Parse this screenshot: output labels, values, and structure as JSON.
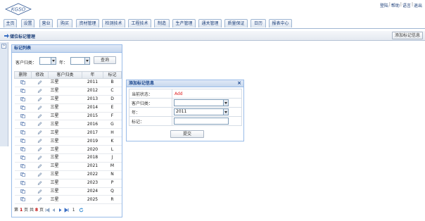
{
  "header": {
    "logo_text": "KGSO",
    "links": [
      "登陆",
      "帮助",
      "语言",
      "退出"
    ]
  },
  "menu": {
    "tabs": [
      "主页",
      "设置",
      "营业",
      "购买",
      "资材管理",
      "检测技术",
      "工程技术",
      "制造",
      "生产管理",
      "通关管理",
      "质量保证",
      "日历",
      "报表中心"
    ]
  },
  "page": {
    "title": "储位标记管理",
    "add_button": "添加标记信息"
  },
  "list_panel": {
    "title": "标记列表",
    "customer_category_label": "客户归类：",
    "customer_category_value": "",
    "year_label": "年：",
    "year_value": "",
    "query_button": "查询",
    "columns": [
      "删除",
      "修改",
      "客户归类",
      "年",
      "标记"
    ],
    "rows": [
      {
        "customer": "三星",
        "year": "2011",
        "mark": "B"
      },
      {
        "customer": "三星",
        "year": "2012",
        "mark": "C"
      },
      {
        "customer": "三星",
        "year": "2013",
        "mark": "D"
      },
      {
        "customer": "三星",
        "year": "2014",
        "mark": "E"
      },
      {
        "customer": "三星",
        "year": "2015",
        "mark": "F"
      },
      {
        "customer": "三星",
        "year": "2016",
        "mark": "G"
      },
      {
        "customer": "三星",
        "year": "2017",
        "mark": "H"
      },
      {
        "customer": "三星",
        "year": "2019",
        "mark": "K"
      },
      {
        "customer": "三星",
        "year": "2020",
        "mark": "L"
      },
      {
        "customer": "三星",
        "year": "2018",
        "mark": "J"
      },
      {
        "customer": "三星",
        "year": "2021",
        "mark": "M"
      },
      {
        "customer": "三星",
        "year": "2022",
        "mark": "N"
      },
      {
        "customer": "三星",
        "year": "2023",
        "mark": "P"
      },
      {
        "customer": "三星",
        "year": "2024",
        "mark": "Q"
      },
      {
        "customer": "三星",
        "year": "2025",
        "mark": "R"
      }
    ],
    "pager": {
      "prefix": "第",
      "current": "1",
      "mid": "页 共",
      "total": "8",
      "suffix": "页",
      "page_input": "1"
    }
  },
  "dialog": {
    "title": "添加标记信息",
    "close": "×",
    "status_label": "当前状态：",
    "status_value": "Add",
    "customer_label": "客户归类：",
    "customer_value": "",
    "year_label": "年：",
    "year_value": "2011",
    "mark_label": "标记：",
    "mark_value": "",
    "submit_button": "提交"
  },
  "colors": {
    "accent": "#15428b",
    "status": "#e02020",
    "panel_border": "#99bbe8"
  }
}
